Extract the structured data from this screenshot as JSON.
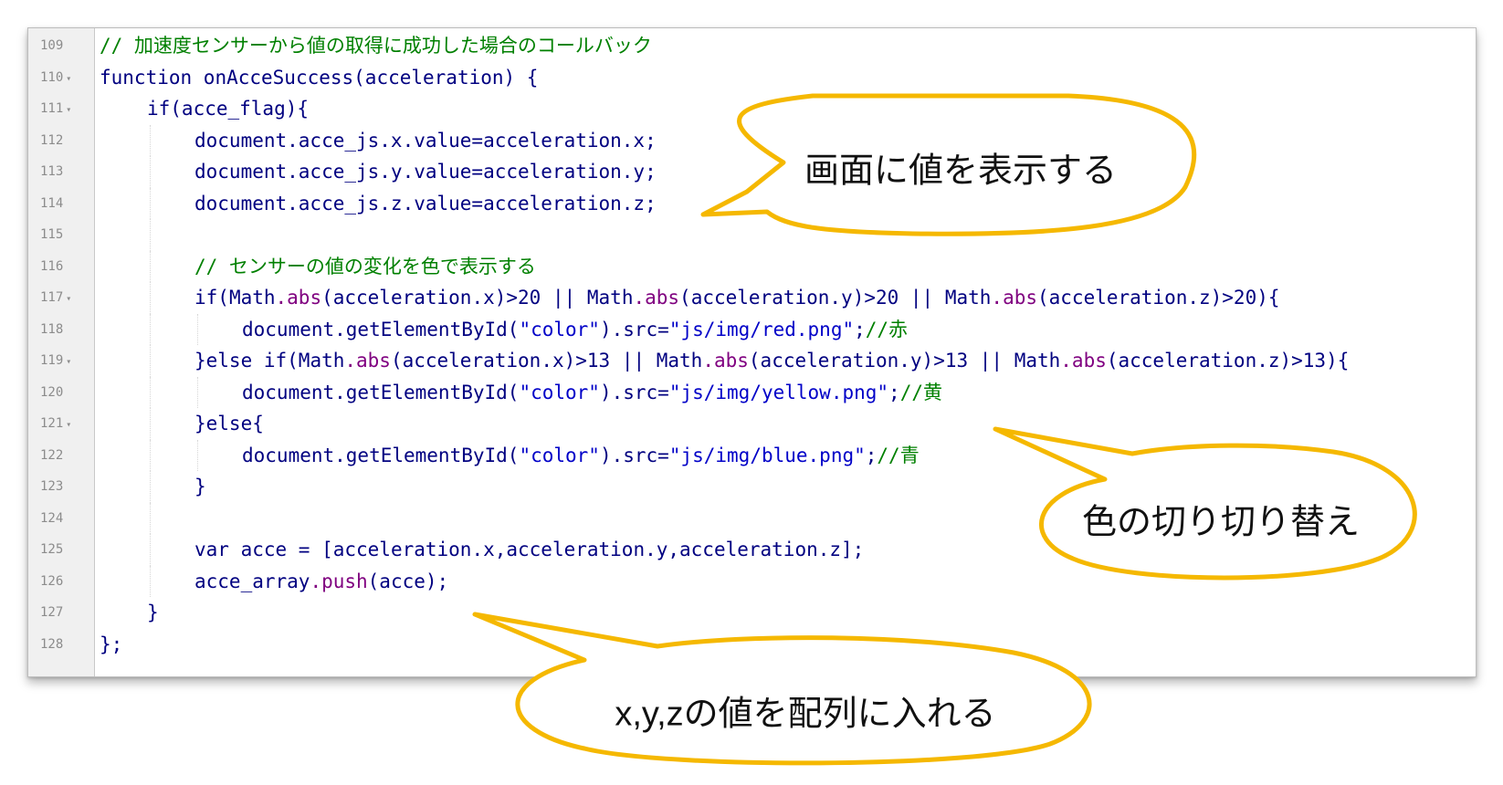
{
  "editor": {
    "lines": [
      {
        "num": "109",
        "fold": false,
        "guides": [],
        "indent": 0,
        "tokens": [
          {
            "t": "// 加速度センサーから値の取得に成功した場合のコールバック",
            "c": "cm"
          }
        ]
      },
      {
        "num": "110",
        "fold": true,
        "guides": [],
        "indent": 0,
        "tokens": [
          {
            "t": "function ",
            "c": "kw"
          },
          {
            "t": "onAcceSuccess(acceleration) {",
            "c": "kw"
          }
        ]
      },
      {
        "num": "111",
        "fold": true,
        "guides": [],
        "indent": 1,
        "tokens": [
          {
            "t": "if(acce_flag){",
            "c": "kw"
          }
        ]
      },
      {
        "num": "112",
        "fold": false,
        "guides": [
          1
        ],
        "indent": 2,
        "tokens": [
          {
            "t": "document.acce_js.x.value=acceleration.x;",
            "c": "kw"
          }
        ]
      },
      {
        "num": "113",
        "fold": false,
        "guides": [
          1
        ],
        "indent": 2,
        "tokens": [
          {
            "t": "document.acce_js.y.value=acceleration.y;",
            "c": "kw"
          }
        ]
      },
      {
        "num": "114",
        "fold": false,
        "guides": [
          1
        ],
        "indent": 2,
        "tokens": [
          {
            "t": "document.acce_js.z.value=acceleration.z;",
            "c": "kw"
          }
        ]
      },
      {
        "num": "115",
        "fold": false,
        "guides": [
          1
        ],
        "indent": 2,
        "tokens": []
      },
      {
        "num": "116",
        "fold": false,
        "guides": [
          1
        ],
        "indent": 2,
        "tokens": [
          {
            "t": "// センサーの値の変化を色で表示する",
            "c": "cm"
          }
        ]
      },
      {
        "num": "117",
        "fold": true,
        "guides": [
          1
        ],
        "indent": 2,
        "tokens": [
          {
            "t": "if(",
            "c": "kw"
          },
          {
            "t": "Math",
            "c": "kw"
          },
          {
            "t": ".abs",
            "c": "fn"
          },
          {
            "t": "(acceleration.x)>20 || ",
            "c": "kw"
          },
          {
            "t": "Math",
            "c": "kw"
          },
          {
            "t": ".abs",
            "c": "fn"
          },
          {
            "t": "(acceleration.y)>20 || ",
            "c": "kw"
          },
          {
            "t": "Math",
            "c": "kw"
          },
          {
            "t": ".abs",
            "c": "fn"
          },
          {
            "t": "(acceleration.z)>20){",
            "c": "kw"
          }
        ]
      },
      {
        "num": "118",
        "fold": false,
        "guides": [
          1,
          2
        ],
        "indent": 3,
        "tokens": [
          {
            "t": "document.getElementById(",
            "c": "kw"
          },
          {
            "t": "\"color\"",
            "c": "st"
          },
          {
            "t": ").src=",
            "c": "kw"
          },
          {
            "t": "\"js/img/red.png\"",
            "c": "st"
          },
          {
            "t": ";",
            "c": "kw"
          },
          {
            "t": "//赤",
            "c": "cm"
          }
        ]
      },
      {
        "num": "119",
        "fold": true,
        "guides": [
          1
        ],
        "indent": 2,
        "tokens": [
          {
            "t": "}else if(",
            "c": "kw"
          },
          {
            "t": "Math",
            "c": "kw"
          },
          {
            "t": ".abs",
            "c": "fn"
          },
          {
            "t": "(acceleration.x)>13 || ",
            "c": "kw"
          },
          {
            "t": "Math",
            "c": "kw"
          },
          {
            "t": ".abs",
            "c": "fn"
          },
          {
            "t": "(acceleration.y)>13 || ",
            "c": "kw"
          },
          {
            "t": "Math",
            "c": "kw"
          },
          {
            "t": ".abs",
            "c": "fn"
          },
          {
            "t": "(acceleration.z)>13){",
            "c": "kw"
          }
        ]
      },
      {
        "num": "120",
        "fold": false,
        "guides": [
          1,
          2
        ],
        "indent": 3,
        "tokens": [
          {
            "t": "document.getElementById(",
            "c": "kw"
          },
          {
            "t": "\"color\"",
            "c": "st"
          },
          {
            "t": ").src=",
            "c": "kw"
          },
          {
            "t": "\"js/img/yellow.png\"",
            "c": "st"
          },
          {
            "t": ";",
            "c": "kw"
          },
          {
            "t": "//黄",
            "c": "cm"
          }
        ]
      },
      {
        "num": "121",
        "fold": true,
        "guides": [
          1
        ],
        "indent": 2,
        "tokens": [
          {
            "t": "}else{",
            "c": "kw"
          }
        ]
      },
      {
        "num": "122",
        "fold": false,
        "guides": [
          1,
          2
        ],
        "indent": 3,
        "tokens": [
          {
            "t": "document.getElementById(",
            "c": "kw"
          },
          {
            "t": "\"color\"",
            "c": "st"
          },
          {
            "t": ").src=",
            "c": "kw"
          },
          {
            "t": "\"js/img/blue.png\"",
            "c": "st"
          },
          {
            "t": ";",
            "c": "kw"
          },
          {
            "t": "//青",
            "c": "cm"
          }
        ]
      },
      {
        "num": "123",
        "fold": false,
        "guides": [
          1
        ],
        "indent": 2,
        "tokens": [
          {
            "t": "}",
            "c": "kw"
          }
        ]
      },
      {
        "num": "124",
        "fold": false,
        "guides": [
          1
        ],
        "indent": 2,
        "tokens": []
      },
      {
        "num": "125",
        "fold": false,
        "guides": [
          1
        ],
        "indent": 2,
        "tokens": [
          {
            "t": "var ",
            "c": "kw"
          },
          {
            "t": "acce = [acceleration.x,acceleration.y,acceleration.z];",
            "c": "kw"
          }
        ]
      },
      {
        "num": "126",
        "fold": false,
        "guides": [
          1
        ],
        "indent": 2,
        "tokens": [
          {
            "t": "acce_array",
            "c": "kw"
          },
          {
            "t": ".push",
            "c": "fn"
          },
          {
            "t": "(acce);",
            "c": "kw"
          }
        ]
      },
      {
        "num": "127",
        "fold": false,
        "guides": [],
        "indent": 1,
        "tokens": [
          {
            "t": "}",
            "c": "kw"
          }
        ]
      },
      {
        "num": "128",
        "fold": false,
        "guides": [],
        "indent": 0,
        "tokens": [
          {
            "t": "};",
            "c": "kw"
          }
        ]
      }
    ],
    "fold_marker": "▾"
  },
  "callouts": {
    "display": "画面に値を表示する",
    "color_switch": "色の切り切り替え",
    "array": "x,y,zの値を配列に入れる"
  },
  "colors": {
    "callout_border": "#f5b800",
    "comment": "#008000",
    "keyword": "#000080",
    "method": "#800080",
    "string": "#0000c8",
    "line_number": "#8c8c8c"
  }
}
